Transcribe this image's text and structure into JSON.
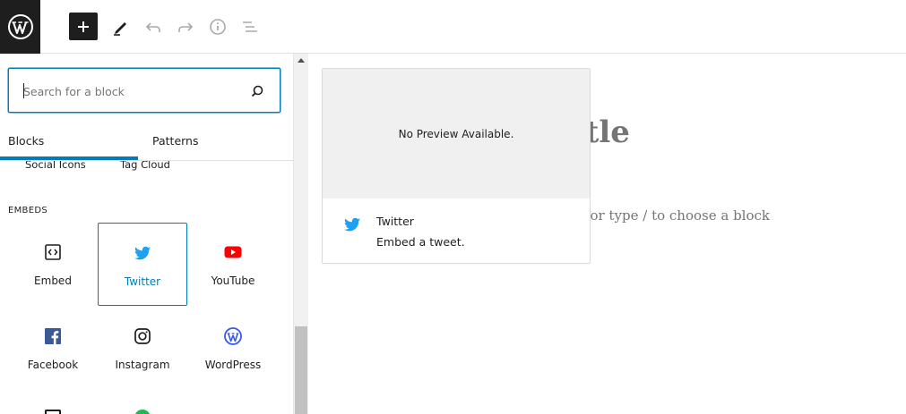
{
  "toolbar": {
    "logo_icon": "wordpress-logo-icon",
    "add_icon": "plus-icon",
    "tools_icon": "pencil-icon",
    "undo_icon": "undo-icon",
    "redo_icon": "redo-icon",
    "info_icon": "info-icon",
    "list_icon": "list-view-icon"
  },
  "inserter": {
    "search_placeholder": "Search for a block",
    "tabs": [
      {
        "label": "Blocks",
        "active": true
      },
      {
        "label": "Patterns",
        "active": false
      }
    ],
    "cut_items": [
      "Social Icons",
      "Tag Cloud"
    ],
    "category": "EMBEDS",
    "blocks": [
      {
        "label": "Embed",
        "icon": "embed-icon",
        "selected": false
      },
      {
        "label": "Twitter",
        "icon": "twitter-icon",
        "selected": true
      },
      {
        "label": "YouTube",
        "icon": "youtube-icon",
        "selected": false
      },
      {
        "label": "Facebook",
        "icon": "facebook-icon",
        "selected": false
      },
      {
        "label": "Instagram",
        "icon": "instagram-icon",
        "selected": false
      },
      {
        "label": "WordPress",
        "icon": "wordpress-icon",
        "selected": false
      }
    ]
  },
  "editor": {
    "title_fragment": "title",
    "hint_fragment": "or type / to choose a block"
  },
  "preview": {
    "no_preview": "No Preview Available.",
    "title": "Twitter",
    "description": "Embed a tweet."
  },
  "colors": {
    "accent": "#007cba",
    "twitter": "#1da1f2",
    "youtube": "#ff0000",
    "facebook": "#3b5998",
    "wordpress": "#3858e9"
  }
}
